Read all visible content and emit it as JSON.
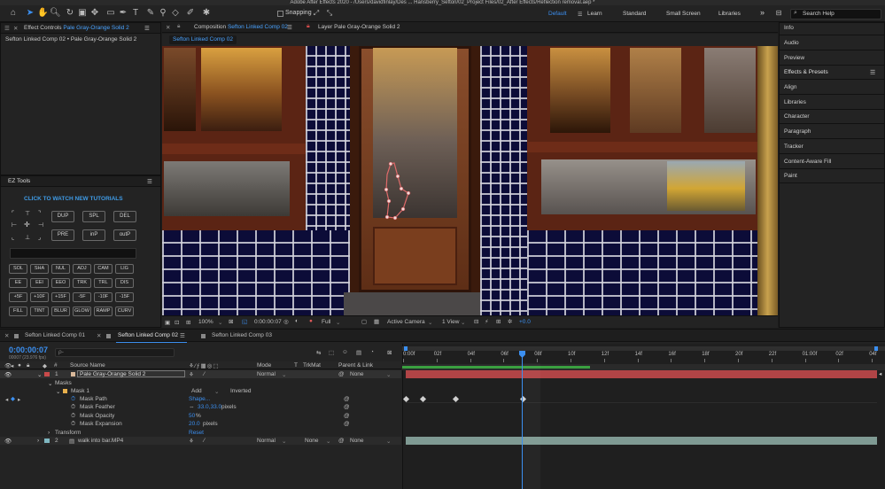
{
  "window": {
    "title": "Adobe After Effects 2020 - /Users/davidfinlay/Des ... Hansberry_Sefton/02_Project Files/02_After Effects/Reflection removal.aep *"
  },
  "toolbar": {
    "snapping_label": "Snapping",
    "workspaces": [
      "Default",
      "Learn",
      "Standard",
      "Small Screen",
      "Libraries"
    ],
    "workspace_overflow": "»",
    "search_placeholder": "Search Help"
  },
  "effect_controls": {
    "tab_prefix": "Effect Controls",
    "tab_layer": "Pale Gray-Orange Solid 2",
    "breadcrumb": "Sefton Linked Comp 02 • Pale Gray-Orange Solid 2"
  },
  "composition_panel": {
    "tab_prefix": "Composition",
    "tab_comp": "Sefton Linked Comp 02",
    "layer_tab": "Layer Pale Gray-Orange Solid 2",
    "sub_tab": "Sefton Linked Comp 02",
    "viewer_bar": {
      "zoom": "100%",
      "timecode": "0:00:00:07",
      "resolution": "Full",
      "camera": "Active Camera",
      "views": "1 View",
      "exposure": "+0.0"
    }
  },
  "ez_tools": {
    "title": "EZ Tools",
    "tutorial_link": "CLICK TO WATCH NEW TUTORIALS",
    "big_buttons": [
      "DUP",
      "SPL",
      "DEL",
      "PRE",
      "inP",
      "outP"
    ],
    "grid_buttons": [
      [
        "SOL",
        "SHA",
        "NUL",
        "ADJ",
        "CAM",
        "LIG"
      ],
      [
        "EE",
        "EEI",
        "EEO",
        "TRK",
        "TRL",
        "DIS"
      ],
      [
        "+5F",
        "+10F",
        "+15F",
        "-5F",
        "-10F",
        "-15F"
      ],
      [
        "FILL",
        "TINT",
        "BLUR",
        "GLOW",
        "RAMP",
        "CURV"
      ]
    ]
  },
  "right_panel": {
    "items": [
      "Info",
      "Audio",
      "Preview",
      "Effects & Presets",
      "Align",
      "Libraries",
      "Character",
      "Paragraph",
      "Tracker",
      "Content-Aware Fill",
      "Paint"
    ]
  },
  "timeline": {
    "tabs": [
      "Sefton Linked Comp 01",
      "Sefton Linked Comp 02",
      "Sefton Linked Comp 03"
    ],
    "timecode": "0:00:00:07",
    "timecode_sub": "00007 (23.976 fps)",
    "search_placeholder": "ρ-",
    "columns": {
      "num": "#",
      "source_name": "Source Name",
      "mode": "Mode",
      "t": "T",
      "trkmat": "TrkMat",
      "parent": "Parent & Link"
    },
    "rows": {
      "layer1": {
        "num": "1",
        "name": "Pale Gray-Orange Solid 2",
        "mode": "Normal",
        "parent": "None"
      },
      "masks": "Masks",
      "mask1": {
        "name": "Mask 1",
        "mode": "Add",
        "inverted": "Inverted"
      },
      "mask_path": {
        "label": "Mask Path",
        "value": "Shape..."
      },
      "mask_feather": {
        "label": "Mask Feather",
        "value": "33.0,33.0",
        "unit": "pixels"
      },
      "mask_opacity": {
        "label": "Mask Opacity",
        "value": "50",
        "unit": "%"
      },
      "mask_expansion": {
        "label": "Mask Expansion",
        "value": "20.0",
        "unit": "pixels"
      },
      "transform": {
        "label": "Transform",
        "value": "Reset"
      },
      "layer2": {
        "num": "2",
        "name": "walk into bar.MP4",
        "mode": "Normal",
        "trkmat": "None",
        "parent": "None"
      }
    },
    "ruler": [
      "0:00f",
      "02f",
      "04f",
      "06f",
      "08f",
      "10f",
      "12f",
      "14f",
      "16f",
      "18f",
      "20f",
      "22f",
      "01:00f",
      "02f",
      "04f"
    ],
    "playhead_frame": 7
  },
  "colors": {
    "accent": "#3b8ff0",
    "layer1_bar": "#b04446",
    "layer2_bar": "#7f9a93",
    "panel_bg": "#232323",
    "label_red": "#c94a4a",
    "label_teal": "#7fb7c1"
  }
}
